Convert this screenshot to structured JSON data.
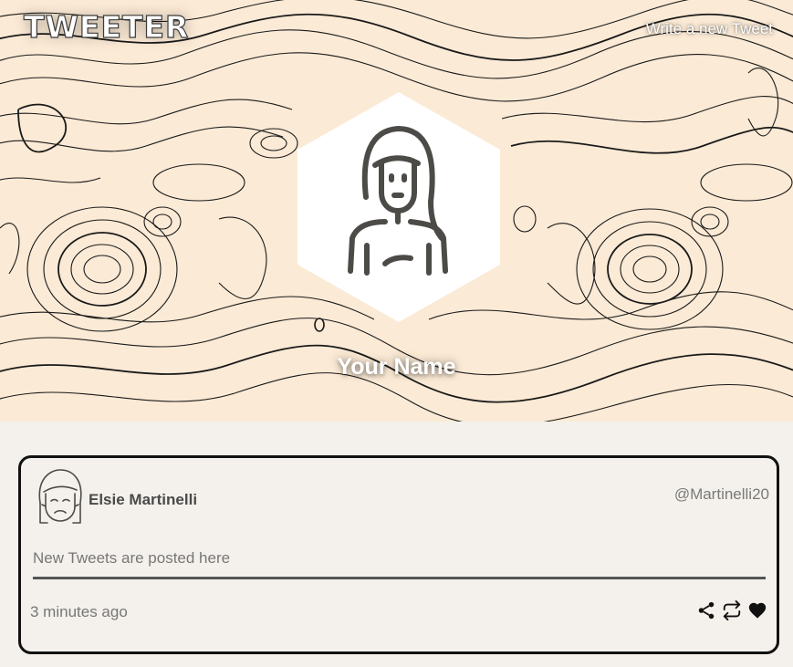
{
  "header": {
    "brand": "TWEETER",
    "new_tweet_label": "Write a new Tweet"
  },
  "profile": {
    "name": "Your Name",
    "avatar_icon": "woman-avatar-icon"
  },
  "tweet": {
    "author_name": "Elsie Martinelli",
    "handle": "@Martinelli20",
    "content": "New Tweets are posted here",
    "timestamp": "3 minutes ago",
    "avatar_icon": "sad-woman-avatar-icon",
    "actions": [
      "share-icon",
      "retweet-icon",
      "like-icon"
    ]
  },
  "colors": {
    "hero_background": "#fbead5",
    "page_background": "#f4f1ec",
    "icon_stroke": "#4d4b47"
  }
}
